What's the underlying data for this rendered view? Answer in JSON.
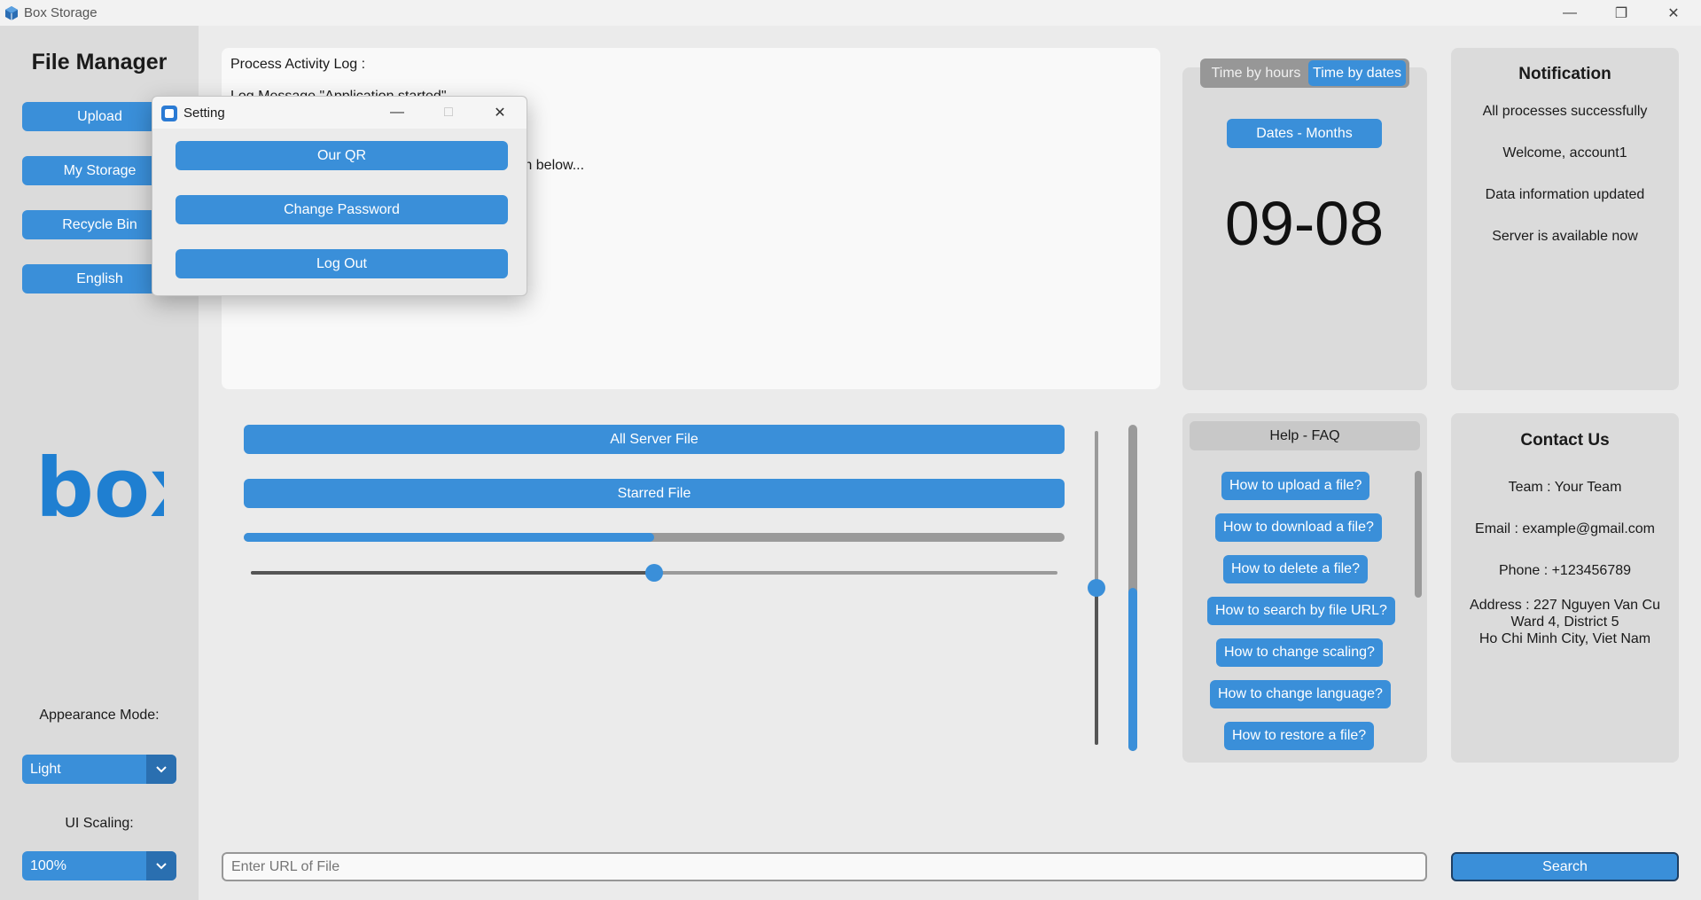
{
  "window": {
    "title": "Box Storage"
  },
  "sidebar": {
    "title": "File Manager",
    "buttons": [
      {
        "label": "Upload"
      },
      {
        "label": "My Storage"
      },
      {
        "label": "Recycle Bin"
      },
      {
        "label": "English"
      }
    ],
    "logo_text": "box",
    "appearance_label": "Appearance Mode:",
    "appearance_value": "Light",
    "scaling_label": "UI Scaling:",
    "scaling_value": "100%"
  },
  "log": {
    "title": "Process Activity Log :",
    "line1": "Log Message \"Application started\"",
    "line2": "in this application. That processes will be shown below..."
  },
  "time_panel": {
    "tab_hours": "Time by hours",
    "tab_dates": "Time by dates",
    "mode_button": "Dates - Months",
    "value": "09-08"
  },
  "notification": {
    "title": "Notification",
    "items": [
      "All processes successfully",
      "Welcome, account1",
      "Data information updated",
      "Server is available now"
    ]
  },
  "center": {
    "all_server_file": "All Server File",
    "starred_file": "Starred File",
    "progress": 0.5,
    "slider": 0.5,
    "vslider": 0.5,
    "vprogress": 0.5
  },
  "faq": {
    "title": "Help - FAQ",
    "items": [
      "How to upload a file?",
      "How to download a file?",
      "How to delete a file?",
      "How to search by file URL?",
      "How to change scaling?",
      "How to change language?",
      "How to restore a file?"
    ]
  },
  "contact": {
    "title": "Contact Us",
    "team": "Team : Your Team",
    "email": "Email : example@gmail.com",
    "phone": "Phone : +123456789",
    "address1": "Address : 227 Nguyen Van Cu",
    "address2": "Ward 4, District 5",
    "address3": "Ho Chi Minh City, Viet Nam"
  },
  "search": {
    "placeholder": "Enter URL of File",
    "button": "Search"
  },
  "dialog": {
    "title": "Setting",
    "buttons": [
      {
        "label": "Our QR"
      },
      {
        "label": "Change Password"
      },
      {
        "label": "Log Out"
      }
    ]
  },
  "colors": {
    "accent": "#3a8fd9",
    "panel": "#dbdbdb",
    "background": "#ebebeb"
  }
}
